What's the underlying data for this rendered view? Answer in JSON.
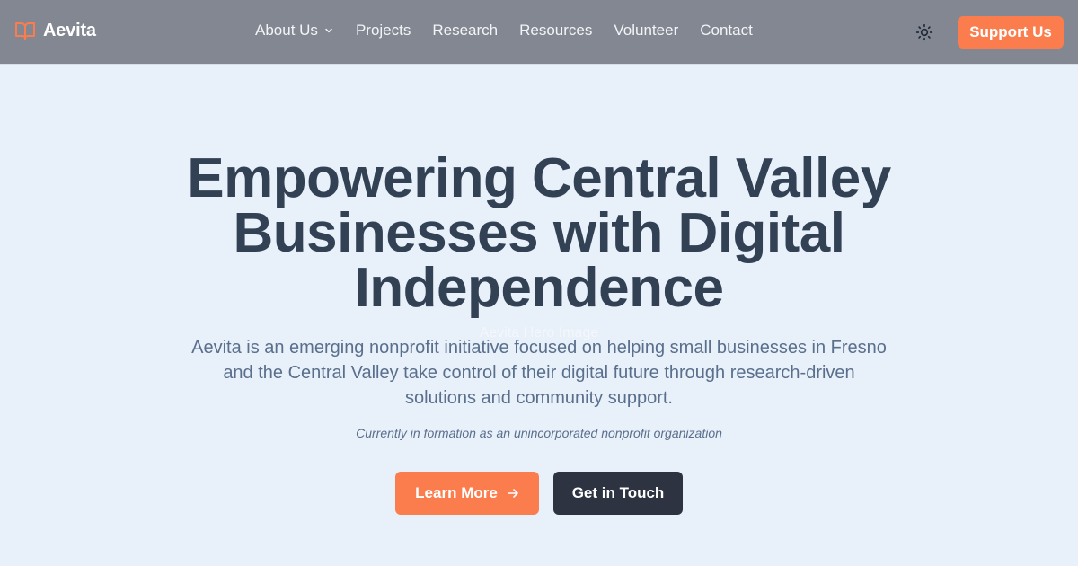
{
  "brand": {
    "name": "Aevita",
    "icon": "book-open-icon"
  },
  "nav": {
    "items": [
      {
        "label": "About Us",
        "has_dropdown": true
      },
      {
        "label": "Projects"
      },
      {
        "label": "Research"
      },
      {
        "label": "Resources"
      },
      {
        "label": "Volunteer"
      },
      {
        "label": "Contact"
      }
    ],
    "theme_toggle_icon": "sun-icon",
    "support_label": "Support Us"
  },
  "hero": {
    "title": "Empowering Central Valley Businesses with Digital Independence",
    "image_alt": "Aevita Hero Image",
    "description": "Aevita is an emerging nonprofit initiative focused on helping small businesses in Fresno and the Central Valley take control of their digital future through research-driven solutions and community support.",
    "note": "Currently in formation as an unincorporated nonprofit organization",
    "primary_cta": "Learn More",
    "primary_cta_icon": "arrow-right-icon",
    "secondary_cta": "Get in Touch"
  },
  "colors": {
    "accent": "#fb7d4d",
    "nav_bg": "#828791",
    "hero_bg": "#e8f0fa",
    "heading": "#334155",
    "body_text": "#5a6f8c",
    "dark_button": "#2d3340"
  }
}
